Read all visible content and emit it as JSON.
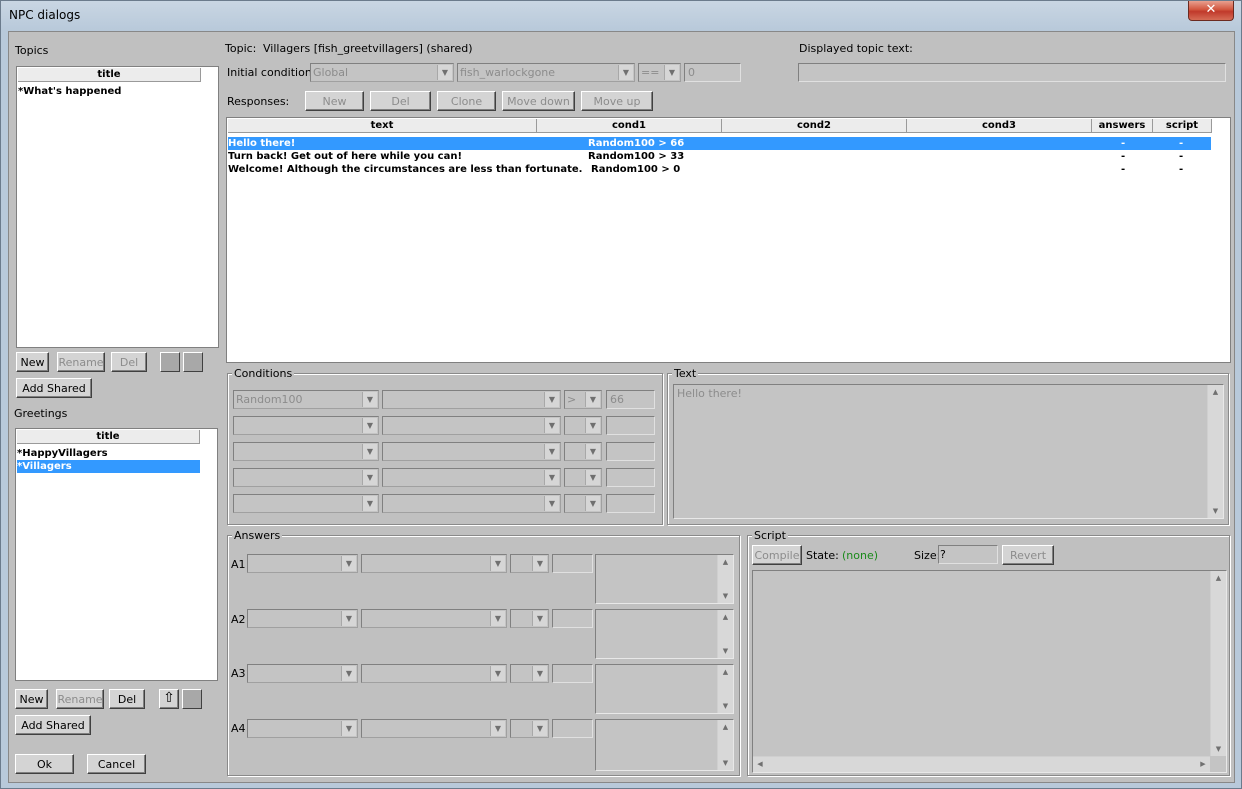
{
  "window": {
    "title": "NPC dialogs",
    "close_glyph": "✕"
  },
  "topics": {
    "label": "Topics",
    "header": "title",
    "items": [
      "*What's happened"
    ],
    "buttons": {
      "new": "New",
      "rename": "Rename",
      "del": "Del",
      "add_shared": "Add Shared"
    }
  },
  "greetings": {
    "label": "Greetings",
    "header": "title",
    "items": [
      "*HappyVillagers",
      "*Villagers"
    ],
    "selected_index": 1,
    "buttons": {
      "new": "New",
      "rename": "Rename",
      "del": "Del",
      "add_shared": "Add Shared",
      "up_icon": "⇧"
    }
  },
  "footer": {
    "ok": "Ok",
    "cancel": "Cancel"
  },
  "topic": {
    "label": "Topic:",
    "value": "Villagers [fish_greetvillagers] (shared)",
    "initial_condition_label": "Initial condition:",
    "cond_type": "Global",
    "cond_var": "fish_warlockgone",
    "cond_op": "==",
    "cond_value": "0",
    "displayed_label": "Displayed topic text:",
    "displayed_value": ""
  },
  "responses": {
    "label": "Responses:",
    "buttons": {
      "new": "New",
      "del": "Del",
      "clone": "Clone",
      "move_down": "Move down",
      "move_up": "Move up"
    },
    "columns": [
      "text",
      "cond1",
      "cond2",
      "cond3",
      "answers",
      "script"
    ],
    "rows": [
      {
        "text": "Hello there!",
        "cond1": "Random100 > 66",
        "cond2": "",
        "cond3": "",
        "answers": "-",
        "script": "-"
      },
      {
        "text": "Turn back! Get out of here while you can!",
        "cond1": "Random100 > 33",
        "cond2": "",
        "cond3": "",
        "answers": "-",
        "script": "-"
      },
      {
        "text": "Welcome! Although the circumstances are less than fortunate.",
        "cond1": "Random100 > 0",
        "cond2": "",
        "cond3": "",
        "answers": "-",
        "script": "-"
      }
    ],
    "selected_index": 0
  },
  "conditions": {
    "label": "Conditions",
    "rows": [
      {
        "type": "Random100",
        "var": "",
        "op": ">",
        "value": "66"
      },
      {
        "type": "",
        "var": "",
        "op": "",
        "value": ""
      },
      {
        "type": "",
        "var": "",
        "op": "",
        "value": ""
      },
      {
        "type": "",
        "var": "",
        "op": "",
        "value": ""
      },
      {
        "type": "",
        "var": "",
        "op": "",
        "value": ""
      }
    ]
  },
  "text_panel": {
    "label": "Text",
    "value": "Hello there!"
  },
  "answers": {
    "label": "Answers",
    "rows": [
      "A1",
      "A2",
      "A3",
      "A4"
    ]
  },
  "script": {
    "label": "Script",
    "compile": "Compile",
    "state_label": "State:",
    "state_value": "(none)",
    "size_label": "Size:",
    "size_value": "?",
    "revert": "Revert"
  },
  "colors": {
    "selection": "#3399ff",
    "state_value": "#1a8a1a"
  }
}
